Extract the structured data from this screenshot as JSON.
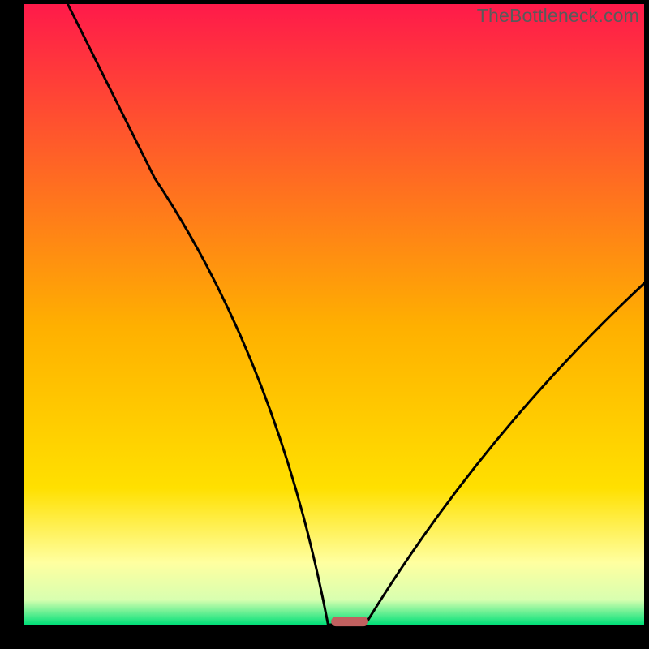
{
  "watermark": "TheBottleneck.com",
  "colors": {
    "top": "#ff1a4a",
    "mid": "#ffd400",
    "nearBottom": "#ffffa0",
    "bottom": "#00e078",
    "curve": "#000000",
    "marker": "#c1605f",
    "frame": "#000000"
  },
  "chart_data": {
    "type": "line",
    "title": "",
    "xlabel": "",
    "ylabel": "",
    "xlim": [
      0,
      100
    ],
    "ylim": [
      0,
      100
    ],
    "grid": false,
    "legend": false,
    "notch_center_x": 52,
    "notch_flat_half_width": 3,
    "left_start": {
      "x": 7,
      "y": 100
    },
    "left_knee": {
      "x": 21,
      "y": 72
    },
    "right_end": {
      "x": 100,
      "y": 55
    },
    "x": [
      7,
      10,
      14,
      18,
      21,
      26,
      30,
      34,
      38,
      42,
      46,
      49,
      51,
      52,
      53,
      55,
      58,
      62,
      66,
      70,
      75,
      80,
      85,
      90,
      95,
      100
    ],
    "values": [
      100,
      92,
      84,
      77,
      72,
      62,
      53,
      45,
      37,
      29,
      20,
      10,
      2,
      0,
      0,
      2,
      8,
      15,
      22,
      28,
      34,
      40,
      45,
      49,
      52,
      55
    ],
    "marker": {
      "x_start": 49.5,
      "x_end": 55.5,
      "y": 0.5
    }
  }
}
